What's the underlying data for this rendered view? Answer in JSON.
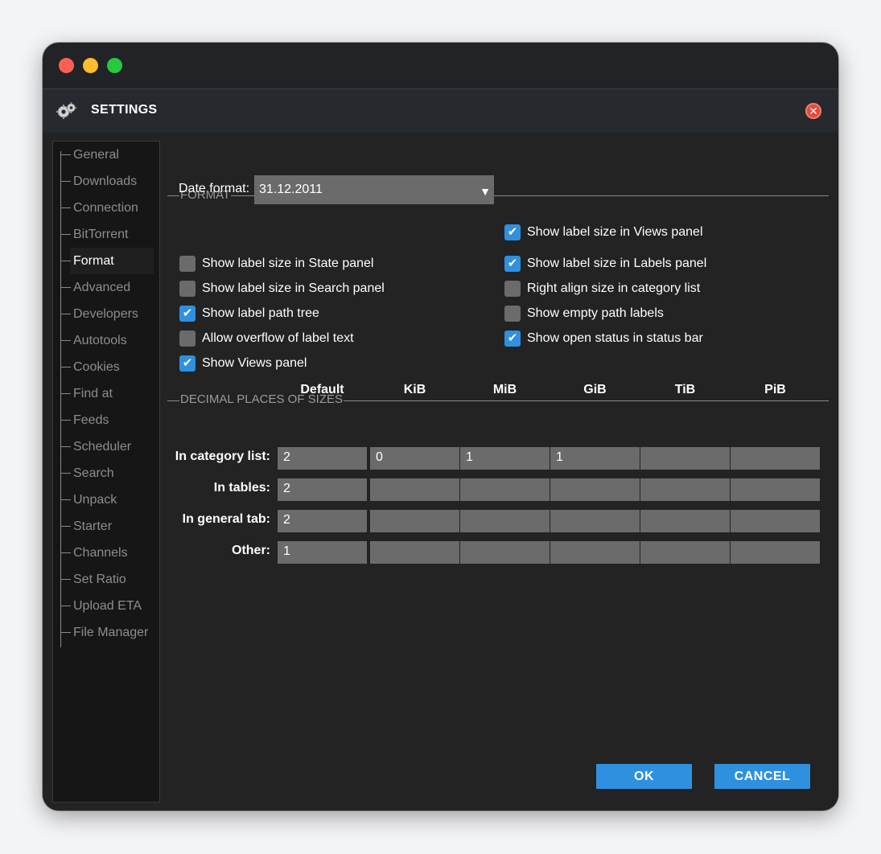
{
  "window": {
    "traffic_lights": [
      "close",
      "minimize",
      "zoom"
    ]
  },
  "dialog": {
    "title": "SETTINGS",
    "icon": "gears-icon",
    "close_icon": "close-icon"
  },
  "sidebar": {
    "active": "Format",
    "items": [
      {
        "label": "General"
      },
      {
        "label": "Downloads"
      },
      {
        "label": "Connection"
      },
      {
        "label": "BitTorrent"
      },
      {
        "label": "Format"
      },
      {
        "label": "Advanced"
      },
      {
        "label": "Developers"
      },
      {
        "label": "Autotools"
      },
      {
        "label": "Cookies"
      },
      {
        "label": "Find at"
      },
      {
        "label": "Feeds"
      },
      {
        "label": "Scheduler"
      },
      {
        "label": "Search"
      },
      {
        "label": "Unpack"
      },
      {
        "label": "Starter"
      },
      {
        "label": "Channels"
      },
      {
        "label": "Set Ratio"
      },
      {
        "label": "Upload ETA"
      },
      {
        "label": "File Manager"
      }
    ]
  },
  "format": {
    "section_title": "FORMAT",
    "date_format_label": "Date format:",
    "date_format_value": "31.12.2011",
    "left_checkboxes": [
      {
        "label": "Show label size in State panel",
        "checked": false
      },
      {
        "label": "Show label size in Search panel",
        "checked": false
      },
      {
        "label": "Show label path tree",
        "checked": true
      },
      {
        "label": "Allow overflow of label text",
        "checked": false
      },
      {
        "label": "Show Views panel",
        "checked": true
      }
    ],
    "right_checkboxes": [
      {
        "label": "Show label size in Views panel",
        "checked": true
      },
      {
        "label": "Show label size in Labels panel",
        "checked": true
      },
      {
        "label": "Right align size in category list",
        "checked": false
      },
      {
        "label": "Show empty path labels",
        "checked": false
      },
      {
        "label": "Show open status in status bar",
        "checked": true
      }
    ]
  },
  "decimals": {
    "section_title": "DECIMAL PLACES OF SIZES",
    "columns": [
      "Default",
      "KiB",
      "MiB",
      "GiB",
      "TiB",
      "PiB"
    ],
    "rows": [
      {
        "label": "In category list:",
        "values": [
          "2",
          "0",
          "1",
          "1",
          "",
          ""
        ]
      },
      {
        "label": "In tables:",
        "values": [
          "2",
          "",
          "",
          "",
          "",
          ""
        ]
      },
      {
        "label": "In general tab:",
        "values": [
          "2",
          "",
          "",
          "",
          "",
          ""
        ]
      },
      {
        "label": "Other:",
        "values": [
          "1",
          "",
          "",
          "",
          "",
          ""
        ]
      }
    ]
  },
  "buttons": {
    "ok": "OK",
    "cancel": "CANCEL"
  },
  "colors": {
    "accent": "#2f90df",
    "dialog_bg": "#232323",
    "header_bg": "#262a2e",
    "field_bg": "#6b6b6b"
  }
}
